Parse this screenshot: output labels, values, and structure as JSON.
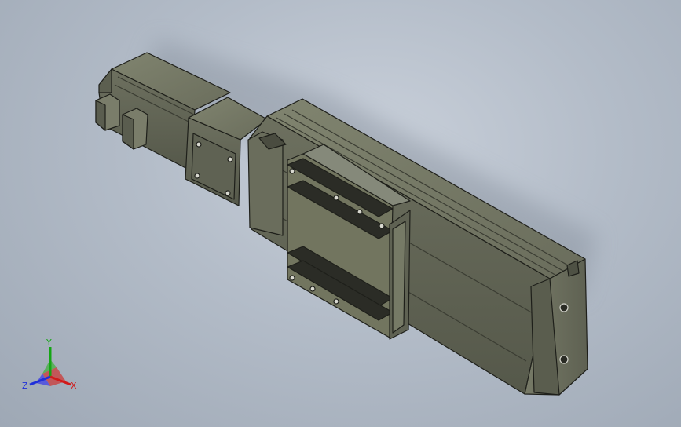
{
  "viewport": {
    "background_color": "#b5bec9",
    "model_color": "#6f7262",
    "edge_color": "#1e1f1a"
  },
  "triad": {
    "x_label": "X",
    "y_label": "Y",
    "z_label": "Z",
    "x_color": "#d11a1a",
    "y_color": "#14a614",
    "z_color": "#1f2fd9"
  }
}
